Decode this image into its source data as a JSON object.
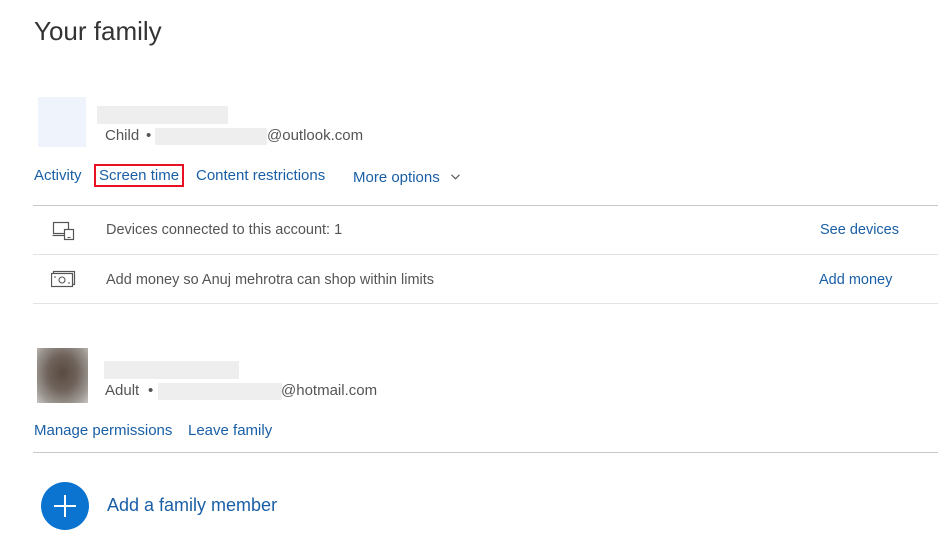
{
  "page": {
    "title": "Your family"
  },
  "child_member": {
    "role": "Child",
    "separator": "•",
    "email_domain": "@outlook.com",
    "actions": {
      "activity": "Activity",
      "screen_time": "Screen time",
      "content_restrictions": "Content restrictions",
      "more_options": "More options"
    },
    "rows": [
      {
        "icon": "devices-icon",
        "text": "Devices connected to this account: 1",
        "link": "See devices"
      },
      {
        "icon": "money-icon",
        "text": "Add money so Anuj mehrotra can shop within limits",
        "link": "Add money"
      }
    ]
  },
  "adult_member": {
    "role": "Adult",
    "separator": "•",
    "email_domain": "@hotmail.com",
    "actions": {
      "manage_permissions": "Manage permissions",
      "leave_family": "Leave family"
    }
  },
  "add_member": {
    "label": "Add a family member",
    "icon": "plus-icon"
  },
  "colors": {
    "link": "#1a5fa6",
    "highlight": "#e81123",
    "add_button": "#0a74d0"
  }
}
